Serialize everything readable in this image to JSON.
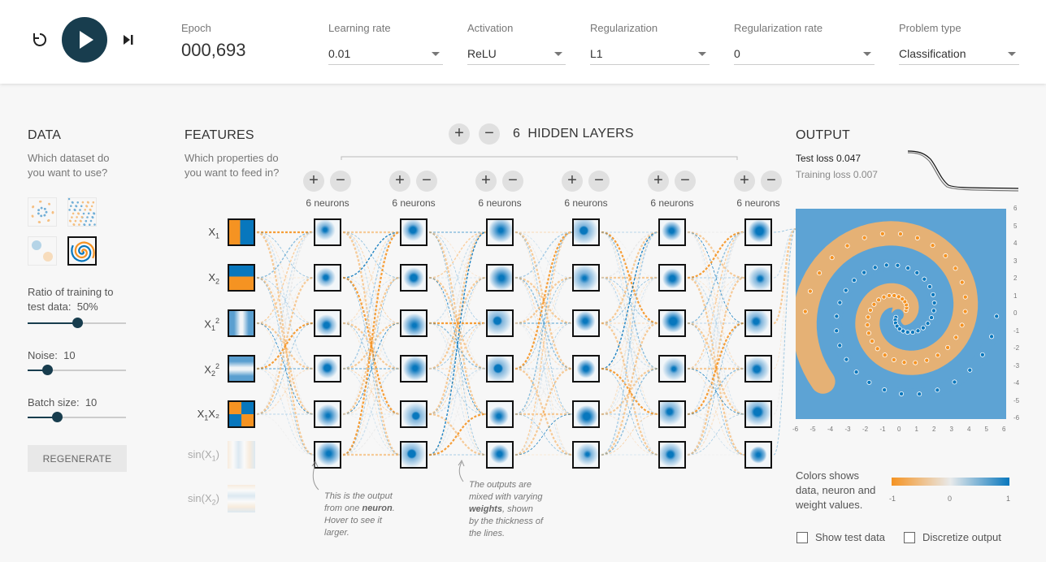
{
  "controls": {
    "reset_icon": "reset-icon",
    "play_icon": "play-icon",
    "step_icon": "step-icon"
  },
  "epoch": {
    "label": "Epoch",
    "value": "000,693"
  },
  "dropdowns": {
    "learning_rate": {
      "label": "Learning rate",
      "value": "0.01"
    },
    "activation": {
      "label": "Activation",
      "value": "ReLU"
    },
    "regularization": {
      "label": "Regularization",
      "value": "L1"
    },
    "regularization_rate": {
      "label": "Regularization rate",
      "value": "0"
    },
    "problem_type": {
      "label": "Problem type",
      "value": "Classification"
    }
  },
  "data_panel": {
    "title": "DATA",
    "subtitle_line1": "Which dataset do",
    "subtitle_line2": "you want to use?",
    "datasets": [
      "circle",
      "xor",
      "gauss",
      "spiral"
    ],
    "selected_dataset": "spiral",
    "ratio": {
      "label_line1": "Ratio of training to",
      "label_line2": "test data:",
      "value": "50%",
      "fraction": 0.5
    },
    "noise": {
      "label": "Noise:",
      "value": "10",
      "fraction": 0.2
    },
    "batch": {
      "label": "Batch size:",
      "value": "10",
      "fraction": 0.3
    },
    "regenerate": "REGENERATE"
  },
  "features_panel": {
    "title": "FEATURES",
    "subtitle_line1": "Which properties do",
    "subtitle_line2": "you want to feed in?",
    "features": [
      {
        "base": "X",
        "sub": "1",
        "sup": "",
        "tail": "",
        "active": true
      },
      {
        "base": "X",
        "sub": "2",
        "sup": "",
        "tail": "",
        "active": true
      },
      {
        "base": "X",
        "sub": "1",
        "sup": "2",
        "tail": "",
        "active": true
      },
      {
        "base": "X",
        "sub": "2",
        "sup": "2",
        "tail": "",
        "active": true
      },
      {
        "base": "X",
        "sub": "1",
        "sup": "",
        "tail": "X₂",
        "active": true
      },
      {
        "base": "sin(X",
        "sub": "1",
        "sup": "",
        "tail": ")",
        "active": false
      },
      {
        "base": "sin(X",
        "sub": "2",
        "sup": "",
        "tail": ")",
        "active": false
      }
    ]
  },
  "hidden": {
    "count": "6",
    "label": "HIDDEN LAYERS",
    "plus": "+",
    "minus": "−",
    "layers": [
      {
        "neurons_label": "6 neurons"
      },
      {
        "neurons_label": "6 neurons"
      },
      {
        "neurons_label": "6 neurons"
      },
      {
        "neurons_label": "6 neurons"
      },
      {
        "neurons_label": "6 neurons"
      },
      {
        "neurons_label": "6 neurons"
      }
    ]
  },
  "notes": {
    "neuron_note": {
      "l1": "This is the output",
      "l2_pre": "from one ",
      "l2_bold": "neuron",
      "l2_post": ".",
      "l3": "Hover to see it",
      "l4": "larger."
    },
    "weights_note": {
      "l1": "The outputs are",
      "l2": "mixed with varying",
      "l3_bold": "weights",
      "l3_post": ", shown",
      "l4": "by the thickness of",
      "l5": "the lines."
    }
  },
  "output_panel": {
    "title": "OUTPUT",
    "test_loss": "Test loss 0.047",
    "training_loss": "Training loss 0.007",
    "axis_ticks_x": [
      "-6",
      "-5",
      "-4",
      "-3",
      "-2",
      "-1",
      "0",
      "1",
      "2",
      "3",
      "4",
      "5",
      "6"
    ],
    "axis_ticks_y": [
      "6",
      "5",
      "4",
      "3",
      "2",
      "1",
      "0",
      "-1",
      "-2",
      "-3",
      "-4",
      "-5",
      "-6"
    ],
    "legend_text_l1": "Colors shows",
    "legend_text_l2": "data, neuron and",
    "legend_text_l3": "weight values.",
    "legend_ticks": [
      "-1",
      "0",
      "1"
    ],
    "show_test_data": "Show test data",
    "discretize_output": "Discretize output"
  },
  "colors": {
    "orange": "#f59322",
    "blue": "#0877bd",
    "light": "#e8eaeb",
    "dark": "#183d4e"
  }
}
